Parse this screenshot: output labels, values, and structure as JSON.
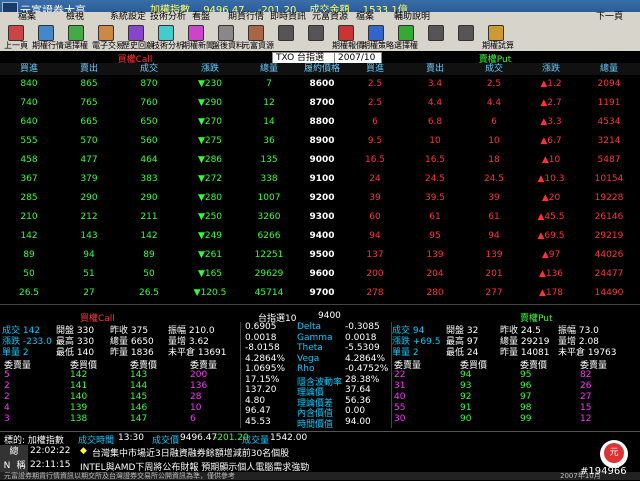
{
  "title": "元富證券大亨",
  "quote": {
    "label": "加權指數",
    "price": "9496.47",
    "change": "-201.20",
    "amount_label": "成交金額",
    "amount": "1533.1億"
  },
  "menu": [
    "檔案",
    "檢視",
    "系統設定",
    "技術分析",
    "看盤",
    "期貨行情",
    "即時資訊",
    "元富資源",
    "檔案",
    "輔助說明",
    "下一頁"
  ],
  "toolbar": [
    "上一頁",
    "期權行情",
    "選擇權",
    "電子交易",
    "歷史回顧",
    "技術分析",
    "期權新聞",
    "盤後資料",
    "元富資源",
    "",
    "",
    "期權報價",
    "期權策略",
    "選擇權",
    "",
    "",
    "期權試算"
  ],
  "selectors": {
    "product": "TXO 台指選",
    "month": "2007/10"
  },
  "headers": {
    "call_title": "買權Call",
    "put_title": "賣權Put",
    "cols": [
      "買進",
      "賣出",
      "成交",
      "漲跌",
      "總量",
      "履約價格",
      "買進",
      "賣出",
      "成交",
      "漲跌",
      "總量"
    ]
  },
  "chain": [
    {
      "cb": "840",
      "cs": "865",
      "cx": "870",
      "cc": "▼230",
      "cv": "7",
      "k": "8600",
      "pb": "2.5",
      "ps": "3.4",
      "px": "2.5",
      "pc": "▲1.2",
      "pv": "2094"
    },
    {
      "cb": "740",
      "cs": "765",
      "cx": "760",
      "cc": "▼290",
      "cv": "12",
      "k": "8700",
      "pb": "2.5",
      "ps": "4.4",
      "px": "4.4",
      "pc": "▲2.7",
      "pv": "1191"
    },
    {
      "cb": "640",
      "cs": "665",
      "cx": "650",
      "cc": "▼270",
      "cv": "14",
      "k": "8800",
      "pb": "6",
      "ps": "6.8",
      "px": "6",
      "pc": "▲3.3",
      "pv": "4534"
    },
    {
      "cb": "555",
      "cs": "570",
      "cx": "560",
      "cc": "▼275",
      "cv": "36",
      "k": "8900",
      "pb": "9.5",
      "ps": "10",
      "px": "10",
      "pc": "▲6.7",
      "pv": "3214"
    },
    {
      "cb": "458",
      "cs": "477",
      "cx": "464",
      "cc": "▼286",
      "cv": "135",
      "k": "9000",
      "pb": "16.5",
      "ps": "16.5",
      "px": "18",
      "pc": "▲10",
      "pv": "5487"
    },
    {
      "cb": "367",
      "cs": "379",
      "cx": "383",
      "cc": "▼272",
      "cv": "338",
      "k": "9100",
      "pb": "24",
      "ps": "24.5",
      "px": "24.5",
      "pc": "▲10.3",
      "pv": "10154"
    },
    {
      "cb": "285",
      "cs": "290",
      "cx": "290",
      "cc": "▼280",
      "cv": "1007",
      "k": "9200",
      "pb": "39",
      "ps": "39.5",
      "px": "39",
      "pc": "▲20",
      "pv": "19228"
    },
    {
      "cb": "210",
      "cs": "212",
      "cx": "211",
      "cc": "▼250",
      "cv": "3260",
      "k": "9300",
      "pb": "60",
      "ps": "61",
      "px": "61",
      "pc": "▲45.5",
      "pv": "26146"
    },
    {
      "cb": "142",
      "cs": "143",
      "cx": "142",
      "cc": "▼249",
      "cv": "6266",
      "k": "9400",
      "pb": "94",
      "ps": "95",
      "px": "94",
      "pc": "▲69.5",
      "pv": "29219"
    },
    {
      "cb": "89",
      "cs": "94",
      "cx": "89",
      "cc": "▼261",
      "cv": "12251",
      "k": "9500",
      "pb": "137",
      "ps": "139",
      "px": "139",
      "pc": "▲97",
      "pv": "44026"
    },
    {
      "cb": "50",
      "cs": "51",
      "cx": "50",
      "cc": "▼165",
      "cv": "29629",
      "k": "9600",
      "pb": "200",
      "ps": "204",
      "px": "201",
      "pc": "▲136",
      "pv": "24477"
    },
    {
      "cb": "26.5",
      "cs": "27",
      "cx": "26.5",
      "cc": "▼120.5",
      "cv": "45714",
      "k": "9700",
      "pb": "278",
      "ps": "280",
      "px": "277",
      "pc": "▲178",
      "pv": "14490"
    },
    {
      "cb": "13",
      "cs": "13.5",
      "cx": "12",
      "cc": "▼83",
      "cv": "48919",
      "k": "9800",
      "pb": "350",
      "ps": "370",
      "px": "364",
      "pc": "▲222",
      "pv": "6798"
    }
  ],
  "detail": {
    "call_title": "買權Call",
    "put_title": "賣權Put",
    "mid_title": "台指選10",
    "strike": "9400",
    "left_lines": [
      "成交 142",
      "開盤 330",
      "昨收 375",
      "振幅 210.0",
      "漲跌 -233.0",
      "最高 330",
      "總量 6650",
      "量增 3.62",
      "單量 2",
      "最低 140",
      "昨量 1836",
      "未平倉 13691"
    ],
    "right_lines": [
      "成交 94",
      "開盤 32",
      "昨收 24.5",
      "振幅 73.0",
      "漲跌 +69.5",
      "最高 97",
      "總量 29219",
      "量增 2.08",
      "單量 2",
      "最低 24",
      "昨量 14081",
      "未平倉 19763"
    ],
    "book_headers": [
      "委賣量",
      "委買價",
      "委賣價",
      "委賣量"
    ],
    "left_book": [
      [
        "5",
        "142",
        "143",
        "200"
      ],
      [
        "2",
        "141",
        "144",
        "136"
      ],
      [
        "2",
        "140",
        "145",
        "28"
      ],
      [
        "4",
        "139",
        "146",
        "10"
      ],
      [
        "3",
        "138",
        "147",
        "6"
      ]
    ],
    "right_book": [
      [
        "22",
        "94",
        "95",
        "82"
      ],
      [
        "31",
        "93",
        "96",
        "26"
      ],
      [
        "40",
        "92",
        "97",
        "27"
      ],
      [
        "55",
        "91",
        "98",
        "15"
      ],
      [
        "30",
        "90",
        "99",
        "12"
      ]
    ],
    "greeks_left": [
      "0.6905",
      "0.0018",
      "-8.0158",
      "4.2864%",
      "1.0695%",
      "17.15%",
      "137.20",
      "4.80",
      "96.47",
      "45.53"
    ],
    "greeks_names": [
      "Delta",
      "Gamma",
      "Theta",
      "Vega",
      "Rho",
      "隱含波動率",
      "理論價",
      "理論價差",
      "內含價值",
      "時間價值"
    ],
    "greeks_right": [
      "-0.3085",
      "0.0018",
      "-5.5309",
      "4.2864%",
      "-0.4752%",
      "28.38%",
      "37.64",
      "56.36",
      "0.00",
      "94.00"
    ]
  },
  "bottom": {
    "label": "標的: 加權指數",
    "time_label": "成交時間",
    "time": "13:30",
    "price_label": "成交價",
    "price": "9496.47",
    "change": "-201.20",
    "volume_label": "成交量",
    "volume": "1542.00"
  },
  "ticker": [
    {
      "time": "22:02:22",
      "text": "台灣集中市場近3日融資融券餘額增減前30名個股"
    },
    {
      "time": "22:11:15",
      "text": "INTEL與AMD下周將公布財報 預期顯示個人電腦需求強勁"
    }
  ],
  "side_labels": [
    "總",
    "稱",
    "N"
  ],
  "status": {
    "left": "元富證券期貨行情資訊以期交所及台灣證券交易所公開資訊為準，僅供參考",
    "right": "2007年10月"
  },
  "watermark": "#194966",
  "colors": {
    "bg": "#000000",
    "call": "#ff3333",
    "put": "#33ff33",
    "header": "#66ccff"
  }
}
